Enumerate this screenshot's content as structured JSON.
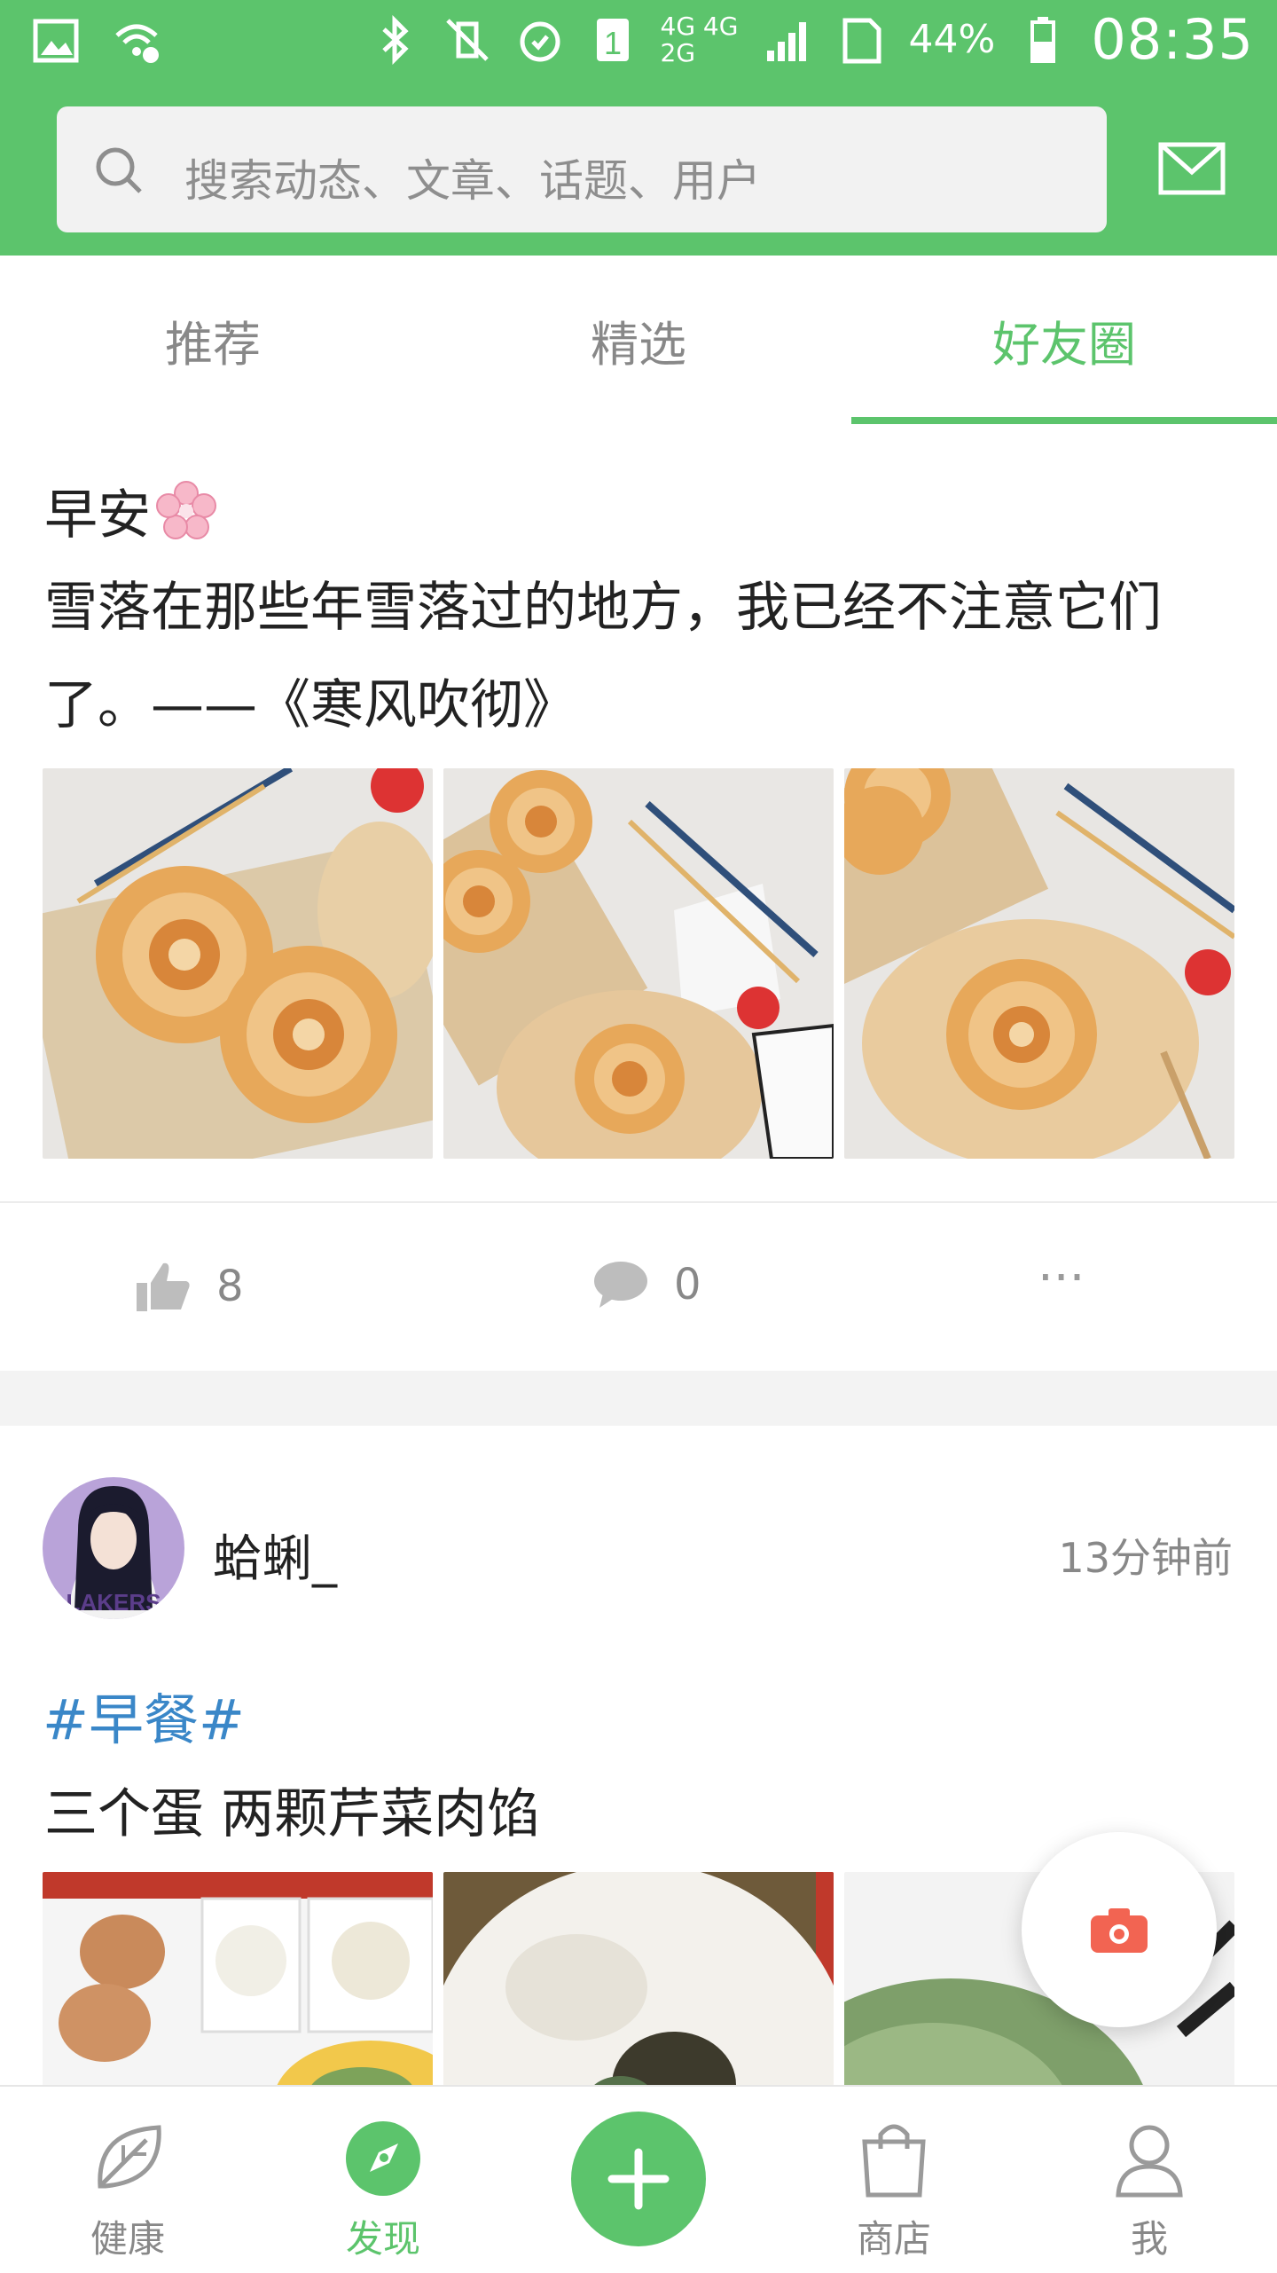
{
  "status_bar": {
    "battery_percent": "44%",
    "time": "08:35",
    "network": "4G 4G 2G"
  },
  "search": {
    "placeholder": "搜索动态、文章、话题、用户"
  },
  "tabs": [
    {
      "label": "推荐",
      "active": false
    },
    {
      "label": "精选",
      "active": false
    },
    {
      "label": "好友圈",
      "active": true
    }
  ],
  "post1": {
    "title": "早安",
    "body": "雪落在那些年雪落过的地方，我已经不注意它们了。——《寒风吹彻》",
    "likes": "8",
    "comments": "0",
    "more": "···"
  },
  "post2": {
    "username": "蛤蜊_",
    "time": "13分钟前",
    "hashtag": "#早餐#",
    "body": "三个蛋 两颗芹菜肉馅"
  },
  "bottom_nav": [
    {
      "label": "健康",
      "icon": "leaf-icon",
      "active": false
    },
    {
      "label": "发现",
      "icon": "compass-icon",
      "active": true
    },
    {
      "label": "",
      "icon": "plus-icon",
      "active": false
    },
    {
      "label": "商店",
      "icon": "shopping-bag-icon",
      "active": false
    },
    {
      "label": "我",
      "icon": "user-icon",
      "active": false
    }
  ],
  "colors": {
    "brand_green": "#5cc46c",
    "hashtag_blue": "#3a87c8",
    "camera_red": "#f26452"
  }
}
